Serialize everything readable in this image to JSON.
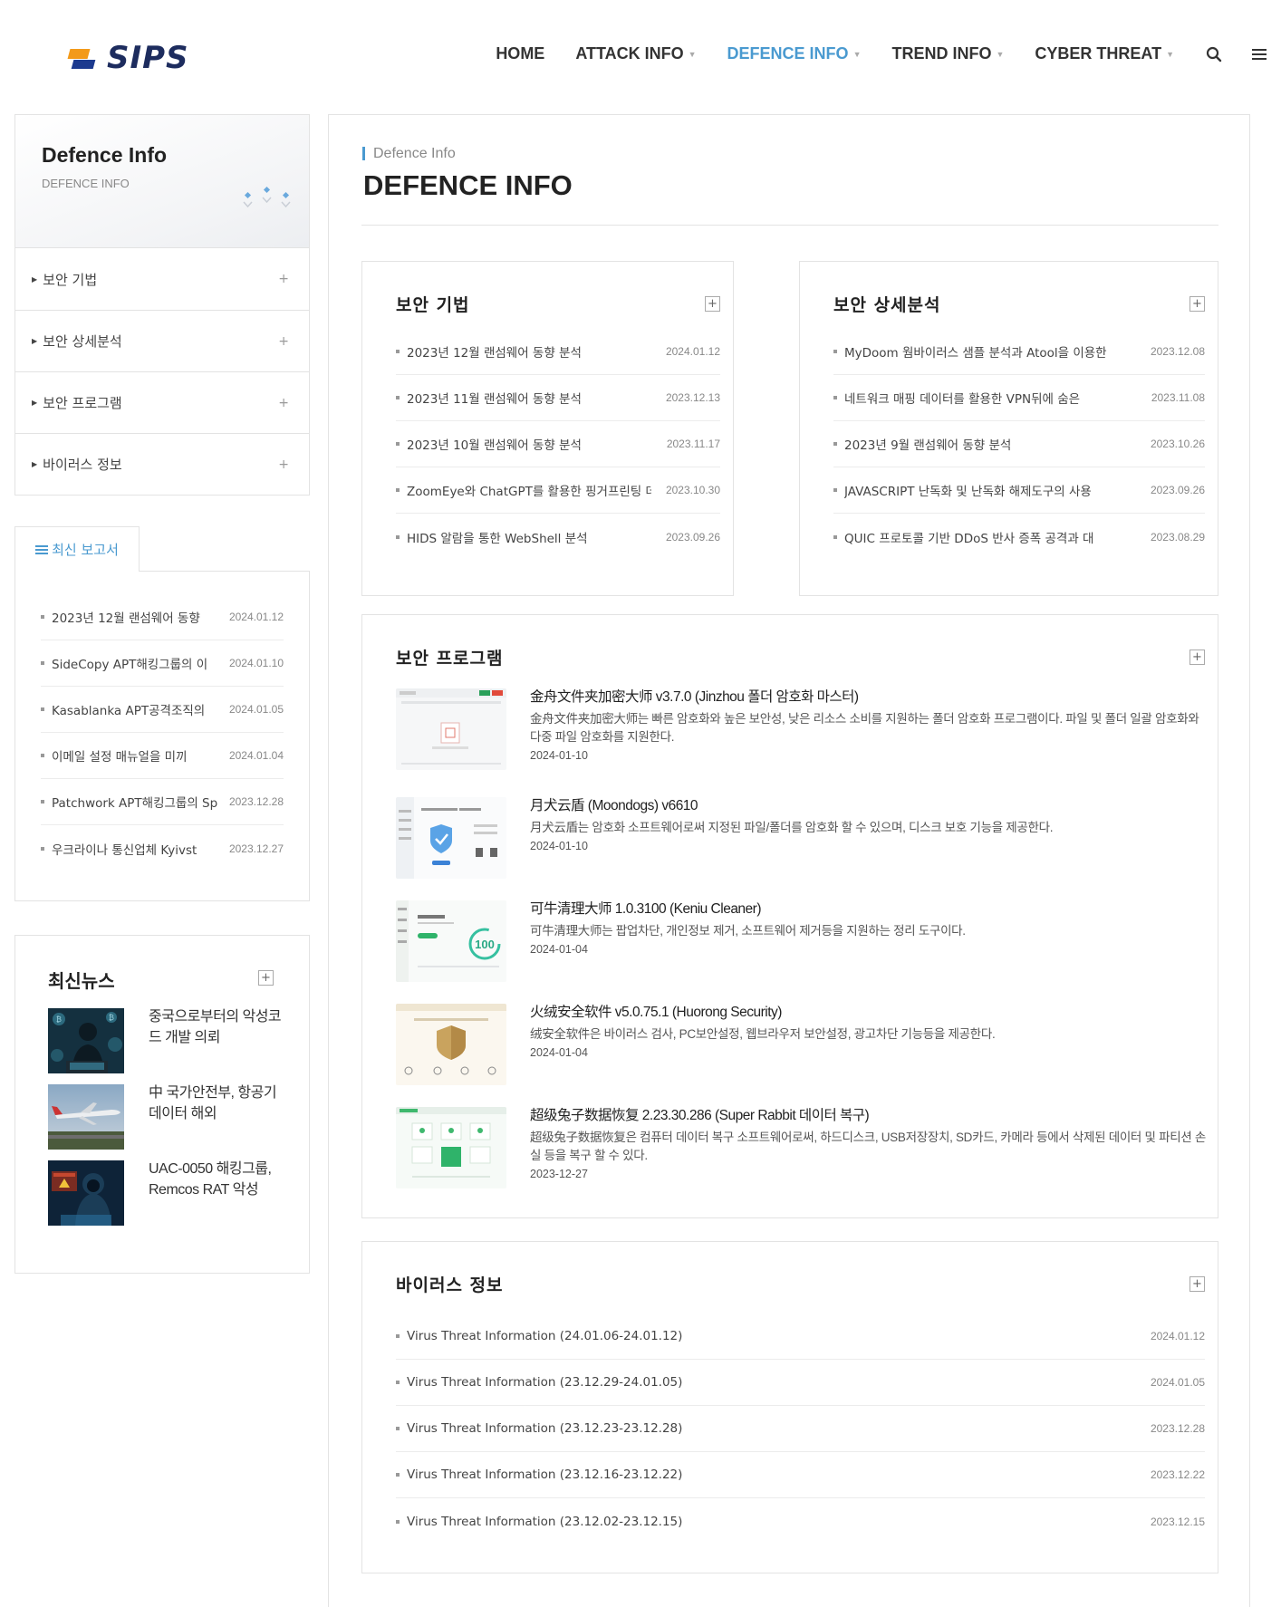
{
  "header": {
    "logo_text": "SIPS",
    "nav": [
      {
        "label": "HOME",
        "has_caret": false,
        "active": false
      },
      {
        "label": "ATTACK INFO",
        "has_caret": true,
        "active": false
      },
      {
        "label": "DEFENCE INFO",
        "has_caret": true,
        "active": true
      },
      {
        "label": "TREND INFO",
        "has_caret": true,
        "active": false
      },
      {
        "label": "CYBER THREAT",
        "has_caret": true,
        "active": false
      }
    ],
    "icons": [
      "search-icon",
      "menu-icon"
    ]
  },
  "sidebar": {
    "title": "Defence Info",
    "subtitle": "DEFENCE INFO",
    "menu": [
      {
        "label": "보안 기법"
      },
      {
        "label": "보안 상세분석"
      },
      {
        "label": "보안 프로그램"
      },
      {
        "label": "바이러스 정보"
      }
    ],
    "menu_plus": "+",
    "reports": {
      "tab_label": "최신 보고서",
      "items": [
        {
          "title": "2023년 12월 랜섬웨어 동향",
          "date": "2024.01.12"
        },
        {
          "title": "SideCopy APT해킹그룹의 이",
          "date": "2024.01.10"
        },
        {
          "title": "Kasablanka APT공격조직의",
          "date": "2024.01.05"
        },
        {
          "title": "이메일 설정 매뉴얼을 미끼",
          "date": "2024.01.04"
        },
        {
          "title": "Patchwork APT해킹그룹의 Sp",
          "date": "2023.12.28"
        },
        {
          "title": "우크라이나 통신업체 Kyivst",
          "date": "2023.12.27"
        }
      ]
    },
    "news": {
      "title": "최신뉴스",
      "items": [
        {
          "text": "중국으로부터의 악성코드 개발 의뢰",
          "thumb": "hacker-thumb"
        },
        {
          "text": "中 국가안전부, 항공기 데이터 해외",
          "thumb": "airplane-thumb"
        },
        {
          "text": "UAC-0050 해킹그룹, Remcos RAT 악성",
          "thumb": "hooded-hacker-thumb"
        }
      ]
    }
  },
  "main": {
    "breadcrumb": "Defence Info",
    "title": "DEFENCE INFO",
    "plus_sign": "+",
    "techniques": {
      "title": "보안 기법",
      "items": [
        {
          "title": "2023년 12월 랜섬웨어 동향 분석",
          "date": "2024.01.12"
        },
        {
          "title": "2023년 11월 랜섬웨어 동향 분석",
          "date": "2023.12.13"
        },
        {
          "title": "2023년 10월 랜섬웨어 동향 분석",
          "date": "2023.11.17"
        },
        {
          "title": "ZoomEye와 ChatGPT를 활용한 핑거프린팅 데이터",
          "date": "2023.10.30"
        },
        {
          "title": "HIDS 알람을 통한 WebShell 분석",
          "date": "2023.09.26"
        }
      ]
    },
    "analysis": {
      "title": "보안 상세분석",
      "items": [
        {
          "title": "MyDoom 웜바이러스 샘플 분석과 Atool을 이용한",
          "date": "2023.12.08"
        },
        {
          "title": "네트워크 매핑 데이터를 활용한 VPN뒤에 숨은",
          "date": "2023.11.08"
        },
        {
          "title": "2023년 9월 랜섬웨어 동향 분석",
          "date": "2023.10.26"
        },
        {
          "title": "JAVASCRIPT 난독화 및 난독화 해제도구의 사용",
          "date": "2023.09.26"
        },
        {
          "title": "QUIC 프로토콜 기반 DDoS 반사 증폭 공격과 대",
          "date": "2023.08.29"
        }
      ]
    },
    "programs": {
      "title": "보안 프로그램",
      "items": [
        {
          "name": "金舟文件夹加密大师 v3.7.0 (Jinzhou 폴더 암호화 마스터)",
          "desc": "金舟文件夹加密大师는 빠른 암호화와 높은 보안성, 낮은 리소스 소비를 지원하는 폴더 암호화 프로그램이다. 파일 및 폴더 일괄 암호화와 다중 파일 암호화를 지원한다.",
          "date": "2024-01-10"
        },
        {
          "name": "月犬云盾 (Moondogs) v6610",
          "desc": "月犬云盾는 암호화 소프트웨어로써 지정된 파일/폴더를 암호화 할 수 있으며, 디스크 보호 기능을 제공한다.",
          "date": "2024-01-10"
        },
        {
          "name": "可牛清理大师 1.0.3100 (Keniu Cleaner)",
          "desc": "可牛清理大师는 팝업차단, 개인정보 제거, 소프트웨어 제거등을 지원하는 정리 도구이다.",
          "date": "2024-01-04"
        },
        {
          "name": "火绒安全软件 v5.0.75.1 (Huorong Security)",
          "desc": "绒安全软件은 바이러스 검사, PC보안설정, 웹브라우저 보안설정, 광고차단 기능등을 제공한다.",
          "date": "2024-01-04"
        },
        {
          "name": "超级兔子数据恢复 2.23.30.286 (Super Rabbit 데이터 복구)",
          "desc": "超级兔子数据恢复은 컴퓨터 데이터 복구 소프트웨어로써, 하드디스크, USB저장장치, SD카드, 카메라 등에서 삭제된 데이터 및 파티션 손실 등을 복구 할 수 있다.",
          "date": "2023-12-27"
        }
      ],
      "thumb_text": "100"
    },
    "virus": {
      "title": "바이러스 정보",
      "items": [
        {
          "title": "Virus Threat Information (24.01.06-24.01.12)",
          "date": "2024.01.12"
        },
        {
          "title": "Virus Threat Information (23.12.29-24.01.05)",
          "date": "2024.01.05"
        },
        {
          "title": "Virus Threat Information (23.12.23-23.12.28)",
          "date": "2023.12.28"
        },
        {
          "title": "Virus Threat Information (23.12.16-23.12.22)",
          "date": "2023.12.22"
        },
        {
          "title": "Virus Threat Information (23.12.02-23.12.15)",
          "date": "2023.12.15"
        }
      ]
    }
  },
  "colors": {
    "accent": "#4a9ad0",
    "logo_orange": "#f39a1a",
    "logo_navy": "#1c3a8f"
  }
}
